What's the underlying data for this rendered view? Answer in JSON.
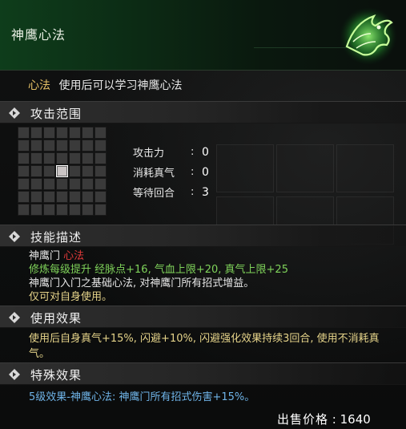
{
  "window": {
    "title": "神鹰心法"
  },
  "item": {
    "type_tag": "心法",
    "type_desc": "使用后可以学习神鹰心法"
  },
  "sections": {
    "range": "攻击范围",
    "skill_desc": "技能描述",
    "use_effect": "使用效果",
    "special_effect": "特殊效果"
  },
  "range_grid": {
    "rows": 7,
    "cols": 7,
    "active_cells": [
      [
        3,
        3
      ]
    ]
  },
  "stats": [
    {
      "label": "攻击力",
      "value": "0"
    },
    {
      "label": "消耗真气",
      "value": "0"
    },
    {
      "label": "等待回合",
      "value": "3"
    }
  ],
  "description": {
    "sect_name": "神鹰门",
    "sect_type": "心法",
    "boost_line": "修炼每级提升 经脉点+16, 气血上限+20, 真气上限+25",
    "basic_line": "神鹰门入门之基础心法, 对神鹰门所有招式增益。",
    "self_only": "仅可对自身使用。"
  },
  "use_effect_text": "使用后自身真气+15%, 闪避+10%, 闪避强化效果持续3回合, 使用不消耗真气。",
  "special_effect_text": "5级效果-神鹰心法: 神鹰门所有招式伤害+15%。",
  "price": {
    "label": "出售价格",
    "value": "1640"
  },
  "colors": {
    "title_green": "#0e3d1b",
    "tag_gold": "#e5c066",
    "sect_red": "#e03a3a",
    "boost_green": "#7fd35a",
    "effect_yellow": "#e6d48a",
    "special_blue": "#6fb4e8"
  },
  "icons": {
    "emblem": "green-eagle-emblem-icon",
    "section_marker": "diamond-arrow-icon"
  }
}
